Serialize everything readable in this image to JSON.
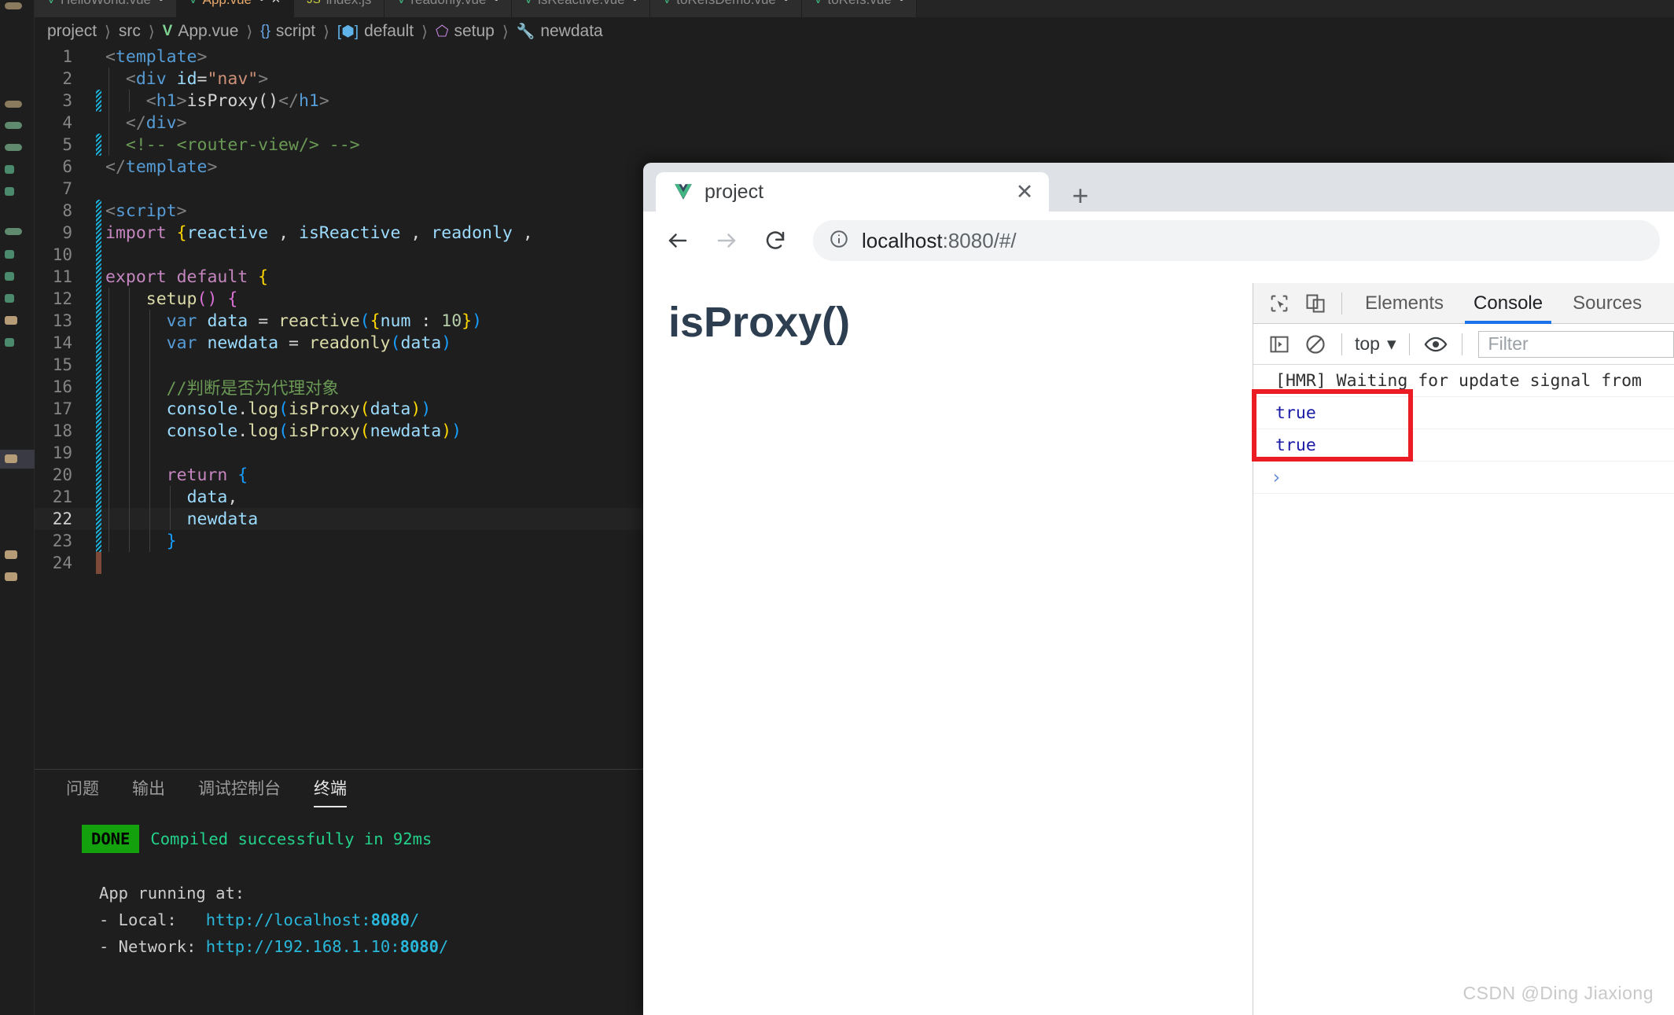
{
  "editor": {
    "tabs": [
      {
        "label": "HelloWorld.vue",
        "icon": "vue-icon",
        "modified": true,
        "active": false
      },
      {
        "label": "App.vue",
        "icon": "vue-icon",
        "modified": true,
        "active": true
      },
      {
        "label": "index.js",
        "icon": "js-icon",
        "modified": false,
        "active": false
      },
      {
        "label": "readonly.vue",
        "icon": "vue-icon",
        "modified": true,
        "active": false
      },
      {
        "label": "isReactive.vue",
        "icon": "vue-icon",
        "modified": true,
        "active": false
      },
      {
        "label": "toRefsDemo.vue",
        "icon": "vue-icon",
        "modified": true,
        "active": false
      },
      {
        "label": "toRefs.vue",
        "icon": "vue-icon",
        "modified": true,
        "active": false
      }
    ],
    "breadcrumb": [
      {
        "label": "project",
        "icon": ""
      },
      {
        "label": "src",
        "icon": ""
      },
      {
        "label": "App.vue",
        "icon": "vue-icon"
      },
      {
        "label": "script",
        "icon": "braces-icon"
      },
      {
        "label": "default",
        "icon": "object-icon"
      },
      {
        "label": "setup",
        "icon": "cube-icon"
      },
      {
        "label": "newdata",
        "icon": "wrench-icon"
      }
    ],
    "lines": [
      {
        "n": "1",
        "indent": 0,
        "current": false,
        "mark": "none"
      },
      {
        "n": "2",
        "indent": 1,
        "current": false,
        "mark": "none"
      },
      {
        "n": "3",
        "indent": 2,
        "current": false,
        "mark": "dirty"
      },
      {
        "n": "4",
        "indent": 1,
        "current": false,
        "mark": "none"
      },
      {
        "n": "5",
        "indent": 1,
        "current": false,
        "mark": "dirty"
      },
      {
        "n": "6",
        "indent": 0,
        "current": false,
        "mark": "none"
      },
      {
        "n": "7",
        "indent": 0,
        "current": false,
        "mark": "none"
      },
      {
        "n": "8",
        "indent": 0,
        "current": false,
        "mark": "dirty"
      },
      {
        "n": "9",
        "indent": 0,
        "current": false,
        "mark": "dirty"
      },
      {
        "n": "10",
        "indent": 0,
        "current": false,
        "mark": "dirty"
      },
      {
        "n": "11",
        "indent": 0,
        "current": false,
        "mark": "dirty"
      },
      {
        "n": "12",
        "indent": 1,
        "current": false,
        "mark": "dirty"
      },
      {
        "n": "13",
        "indent": 2,
        "current": false,
        "mark": "dirty"
      },
      {
        "n": "14",
        "indent": 2,
        "current": false,
        "mark": "dirty"
      },
      {
        "n": "15",
        "indent": 2,
        "current": false,
        "mark": "dirty"
      },
      {
        "n": "16",
        "indent": 2,
        "current": false,
        "mark": "dirty"
      },
      {
        "n": "17",
        "indent": 2,
        "current": false,
        "mark": "dirty"
      },
      {
        "n": "18",
        "indent": 2,
        "current": false,
        "mark": "dirty"
      },
      {
        "n": "19",
        "indent": 2,
        "current": false,
        "mark": "dirty"
      },
      {
        "n": "20",
        "indent": 2,
        "current": false,
        "mark": "dirty"
      },
      {
        "n": "21",
        "indent": 3,
        "current": false,
        "mark": "dirty"
      },
      {
        "n": "22",
        "indent": 3,
        "current": true,
        "mark": "dirty"
      },
      {
        "n": "23",
        "indent": 2,
        "current": false,
        "mark": "dirty"
      },
      {
        "n": "24",
        "indent": 0,
        "current": false,
        "mark": "added"
      }
    ],
    "code_text": [
      "<template>",
      "  <div id=\"nav\">",
      "    <h1>isProxy()</h1>",
      "  </div>",
      "  <!-- <router-view/> -->",
      "</template>",
      "",
      "<script>",
      "import {reactive , isReactive , readonly ,",
      "",
      "export default {",
      "    setup() {",
      "      var data = reactive({num : 10})",
      "      var newdata = readonly(data)",
      "",
      "      //判断是否为代理对象",
      "      console.log(isProxy(data))",
      "      console.log(isProxy(newdata))",
      "",
      "      return {",
      "        data,",
      "        newdata",
      "      }",
      ""
    ]
  },
  "panel": {
    "tabs": [
      {
        "label": "问题",
        "active": false
      },
      {
        "label": "输出",
        "active": false
      },
      {
        "label": "调试控制台",
        "active": false
      },
      {
        "label": "终端",
        "active": true
      }
    ],
    "terminal": {
      "status_badge": "DONE",
      "status_text": "Compiled successfully in 92ms",
      "app_running_label": "App running at:",
      "local_label": "- Local:",
      "local_url_prefix": "http://localhost:",
      "local_port": "8080",
      "local_url_suffix": "/",
      "network_label": "- Network:",
      "network_url_prefix": "http://192.168.1.10:",
      "network_port": "8080",
      "network_url_suffix": "/"
    }
  },
  "browser": {
    "tab_title": "project",
    "tab_favicon": "vue-icon",
    "close_label": "✕",
    "new_tab_label": "+",
    "url": "localhost",
    "url_rest": ":8080/#/",
    "page_heading": "isProxy()"
  },
  "devtools": {
    "tabs": [
      {
        "label": "Elements",
        "active": false
      },
      {
        "label": "Console",
        "active": true
      },
      {
        "label": "Sources",
        "active": false
      }
    ],
    "toolbar": {
      "context": "top",
      "chevron": "▾",
      "filter_placeholder": "Filter"
    },
    "console_messages": [
      {
        "text": "[HMR] Waiting for update signal from",
        "kind": "info"
      },
      {
        "text": "true",
        "kind": "value"
      },
      {
        "text": "true",
        "kind": "value"
      }
    ],
    "prompt": "›",
    "highlight_color": "#ec1c24"
  },
  "watermark": "CSDN @Ding Jiaxiong"
}
